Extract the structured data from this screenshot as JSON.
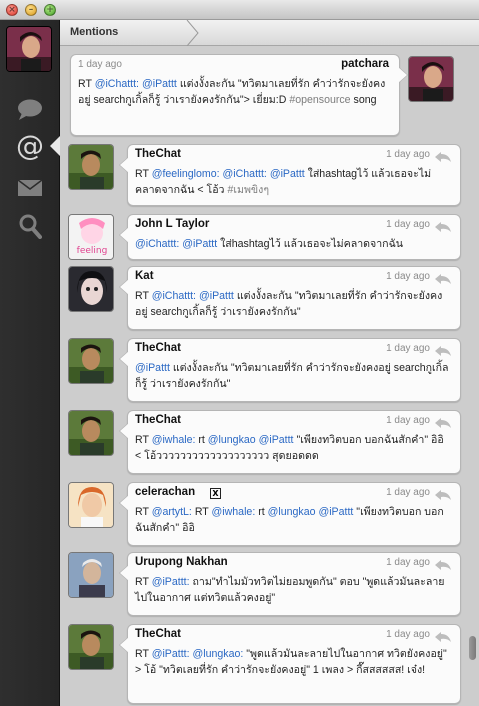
{
  "window": {
    "title": "Mentions",
    "controls": [
      "close",
      "minimize",
      "zoom"
    ]
  },
  "sidebar": {
    "items": [
      {
        "name": "timeline",
        "icon": "speech-bubble-icon"
      },
      {
        "name": "mentions",
        "icon": "at-sign-icon",
        "active": true
      },
      {
        "name": "direct-messages",
        "icon": "envelope-icon"
      },
      {
        "name": "search",
        "icon": "magnifier-icon"
      }
    ]
  },
  "tweets": [
    {
      "user": "patchara",
      "time": "1 day ago",
      "own": true,
      "text": [
        {
          "t": "RT "
        },
        {
          "m": "@iChattt:"
        },
        {
          "t": " "
        },
        {
          "m": "@iPattt"
        },
        {
          "t": " แต่งงั้งละกัน \"ทวิตมาเลยที่รัก คำว่ารักจะยังคงอยู่ searchกูเกิ้ลก็รู้ ว่าเรายังคงรักกัน\"> เยี่ยม:D "
        },
        {
          "h": "#opensource"
        },
        {
          "t": " song"
        }
      ]
    },
    {
      "user": "TheChat",
      "time": "1 day ago",
      "text": [
        {
          "t": "RT "
        },
        {
          "m": "@feelinglomo:"
        },
        {
          "t": " "
        },
        {
          "m": "@iChattt:"
        },
        {
          "t": " "
        },
        {
          "m": "@iPattt"
        },
        {
          "t": " ใส่hashtagไว้ แล้วเธอจะไม่คลาดจากฉัน < โอ้ว "
        },
        {
          "h": "#เมพขิงๆ"
        }
      ]
    },
    {
      "user": "John L Taylor",
      "time": "1 day ago",
      "text": [
        {
          "m": "@iChattt:"
        },
        {
          "t": " "
        },
        {
          "m": "@iPattt"
        },
        {
          "t": " ใส่hashtagไว้ แล้วเธอจะไม่คลาดจากฉัน"
        }
      ]
    },
    {
      "user": "Kat",
      "time": "1 day ago",
      "text": [
        {
          "t": "RT "
        },
        {
          "m": "@iChattt:"
        },
        {
          "t": " "
        },
        {
          "m": "@iPattt"
        },
        {
          "t": " แต่งงั้งละกัน \"ทวิตมาเลยที่รัก คำว่ารักจะยังคงอยู่ searchกูเกิ้ลก็รู้ ว่าเรายังคงรักกัน\""
        }
      ]
    },
    {
      "user": "TheChat",
      "time": "1 day ago",
      "text": [
        {
          "m": "@iPattt"
        },
        {
          "t": " แต่งงั้งละกัน \"ทวิตมาเลยที่รัก คำว่ารักจะยังคงอยู่ searchกูเกิ้ลก็รู้ ว่าเรายังคงรักกัน\""
        }
      ]
    },
    {
      "user": "TheChat",
      "time": "1 day ago",
      "text": [
        {
          "t": "RT "
        },
        {
          "m": "@iwhale:"
        },
        {
          "t": " rt "
        },
        {
          "m": "@lungkao"
        },
        {
          "t": " "
        },
        {
          "m": "@iPattt"
        },
        {
          "t": " \"เพียงทวิตบอก บอกฉันสักคำ\" อิอิ < โอ้ววววววววววววววววววว สุดยอดดด"
        }
      ]
    },
    {
      "user": "celerachan",
      "time": "1 day ago",
      "badge": "X",
      "text": [
        {
          "t": "RT "
        },
        {
          "m": "@artytL:"
        },
        {
          "t": " RT "
        },
        {
          "m": "@iwhale:"
        },
        {
          "t": " rt "
        },
        {
          "m": "@lungkao"
        },
        {
          "t": " "
        },
        {
          "m": "@iPattt"
        },
        {
          "t": " \"เพียงทวิตบอก บอกฉันสักคำ\" อิอิ"
        }
      ]
    },
    {
      "user": "Urupong Nakhan",
      "time": "1 day ago",
      "text": [
        {
          "t": "RT "
        },
        {
          "m": "@iPattt:"
        },
        {
          "t": " ถาม\"ทำไมมัวทวิตไม่ยอมพูดกัน\" ตอบ \"พูดแล้วมันละลายไปในอากาศ แต่ทวิตแล้วคงอยู่\""
        }
      ]
    },
    {
      "user": "TheChat",
      "time": "1 day ago",
      "text": [
        {
          "t": "RT "
        },
        {
          "m": "@iPattt:"
        },
        {
          "t": " "
        },
        {
          "m": "@lungkao:"
        },
        {
          "t": " \"พูดแล้วมันละลายไปในอากาศ ทวิตยังคงอยู่\" > โอ้ \"ทวิตเลยที่รัก คำว่ารักจะยังคงอยู่\" 1 เพลง > กี๊สสสสสส! เจ๋ง!"
        }
      ]
    }
  ],
  "colors": {
    "mention": "#2a68c4",
    "hashtag": "#7d7d7d",
    "sidebar": "#2b2b2b",
    "timeline_bg": "#cdcdcd",
    "bubble": "#fbfbfb"
  }
}
